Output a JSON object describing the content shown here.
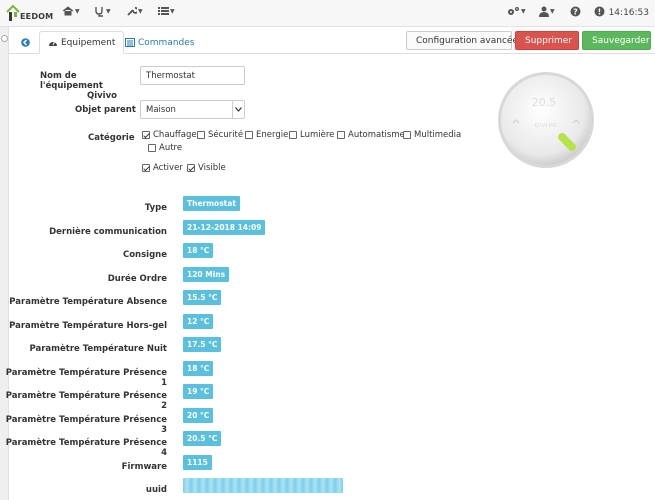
{
  "navbar": {
    "brand": "EEDOM",
    "clock": "14:16:53"
  },
  "tabs": {
    "equipment": "Equipement",
    "commands": "Commandes"
  },
  "actions": {
    "config": "Configuration avancée",
    "delete": "Supprimer",
    "save": "Sauvegarder"
  },
  "form": {
    "name_label_1": "Nom de l'équipement",
    "name_label_2": "Qivivo",
    "name_value": "Thermostat",
    "parent_label": "Objet parent",
    "parent_value": "Maison",
    "category_label": "Catégorie",
    "categories": [
      {
        "label": "Chauffage",
        "checked": true
      },
      {
        "label": "Sécurité",
        "checked": false
      },
      {
        "label": "Energie",
        "checked": false
      },
      {
        "label": "Lumière",
        "checked": false
      },
      {
        "label": "Automatisme",
        "checked": false
      },
      {
        "label": "Multimedia",
        "checked": false
      },
      {
        "label": "Autre",
        "checked": false
      }
    ],
    "activate": "Activer",
    "visible": "Visible"
  },
  "info": [
    {
      "label": "Type",
      "value": "Thermostat"
    },
    {
      "label": "Dernière communication",
      "value": "21-12-2018 14:09"
    },
    {
      "label": "Consigne",
      "value": "18 °C"
    },
    {
      "label": "Durée Ordre",
      "value": "120 Mins"
    },
    {
      "label": "Paramètre Température Absence",
      "value": "15.5 °C"
    },
    {
      "label": "Paramètre Température Hors-gel",
      "value": "12 °C"
    },
    {
      "label": "Paramètre Température Nuit",
      "value": "17.5 °C"
    },
    {
      "label": "Paramètre Température Présence 1",
      "value": "18 °C"
    },
    {
      "label": "Paramètre Température Présence 2",
      "value": "19 °C"
    },
    {
      "label": "Paramètre Température Présence 3",
      "value": "20 °C"
    },
    {
      "label": "Paramètre Température Présence 4",
      "value": "20.5 °C"
    },
    {
      "label": "Firmware",
      "value": "1115"
    },
    {
      "label": "uuid",
      "value": ""
    }
  ],
  "thermostat": {
    "display_temp": "20.5",
    "brand": "QIVIVO"
  },
  "colors": {
    "badge": "#5bc0de",
    "danger": "#d9534f",
    "success": "#5cb85c",
    "link": "#2a7ab8",
    "thermo_led": "#b7e34a"
  }
}
